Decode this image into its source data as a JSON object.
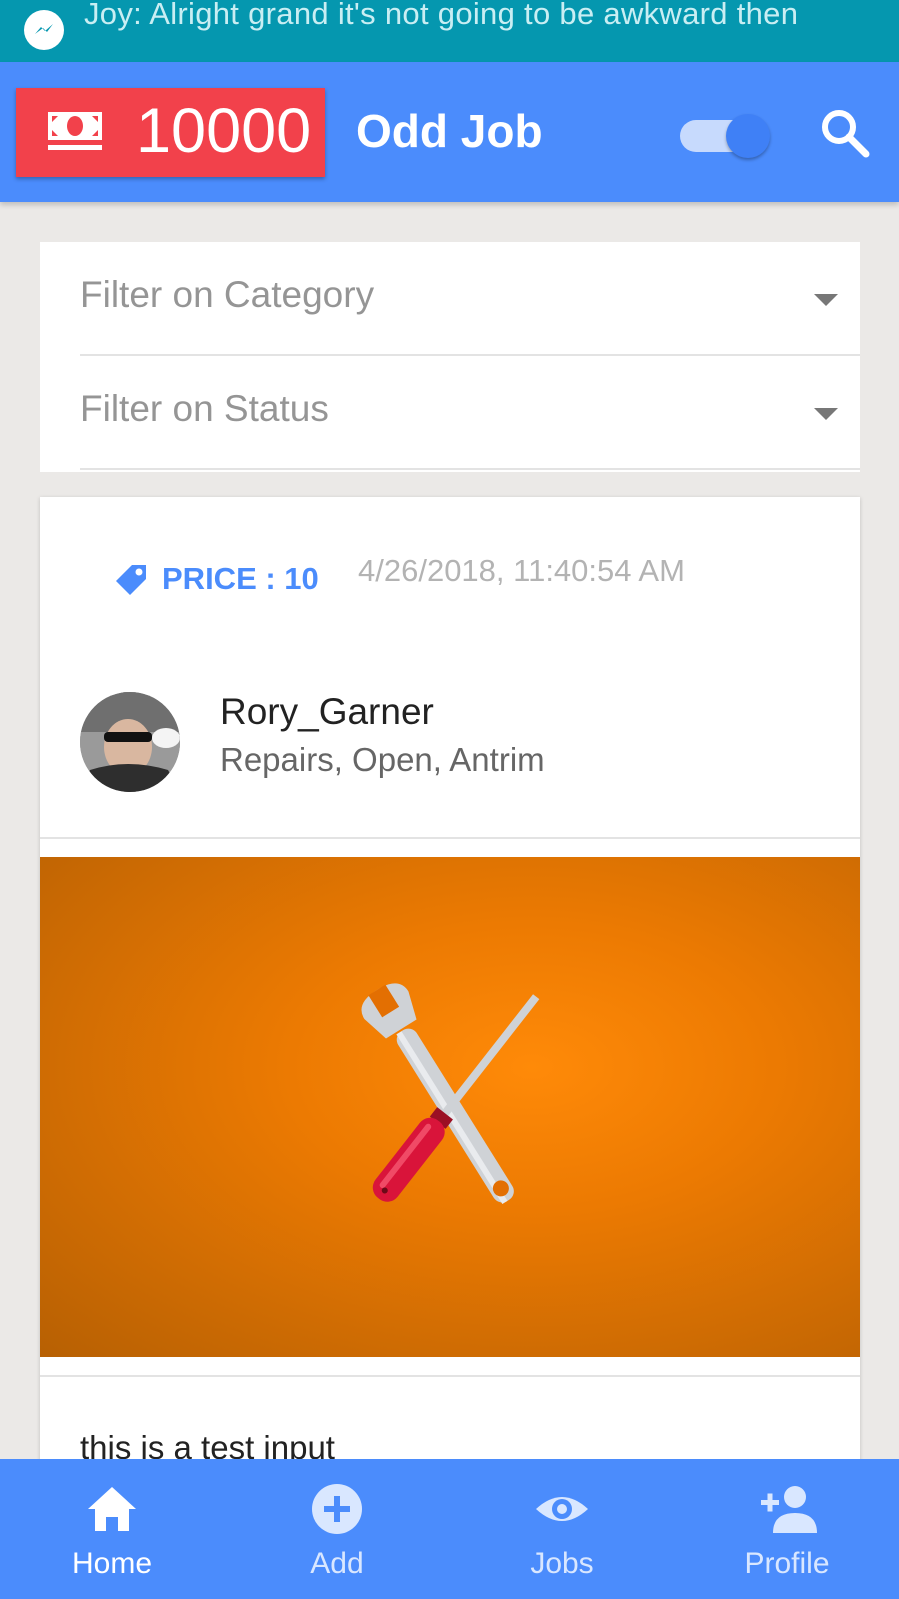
{
  "notification": {
    "icon": "messenger-icon",
    "text": "Joy: Alright grand it's not going to be awkward then"
  },
  "appbar": {
    "credits_icon": "money-icon",
    "credits": "10000",
    "title": "Odd Job",
    "toggle_on": true,
    "search_icon": "search-icon"
  },
  "filters": {
    "category_placeholder": "Filter on Category",
    "status_placeholder": "Filter on Status"
  },
  "job": {
    "price_icon": "tag-icon",
    "price_label": "PRICE : 10",
    "timestamp": "4/26/2018, 11:40:54 AM",
    "user_name": "Rory_Garner",
    "meta": "Repairs, Open, Antrim",
    "image": "wrench-screwdriver-illustration",
    "description": "this is a test input"
  },
  "nav": {
    "items": [
      {
        "label": "Home",
        "icon": "home-icon",
        "active": true
      },
      {
        "label": "Add",
        "icon": "add-icon",
        "active": false
      },
      {
        "label": "Jobs",
        "icon": "eye-icon",
        "active": false
      },
      {
        "label": "Profile",
        "icon": "add-person-icon",
        "active": false
      }
    ]
  },
  "colors": {
    "primary": "#4b8cfc",
    "accent_red": "#f2414b",
    "notification_bar": "#0597af",
    "image_orange": "#ec7a02"
  }
}
